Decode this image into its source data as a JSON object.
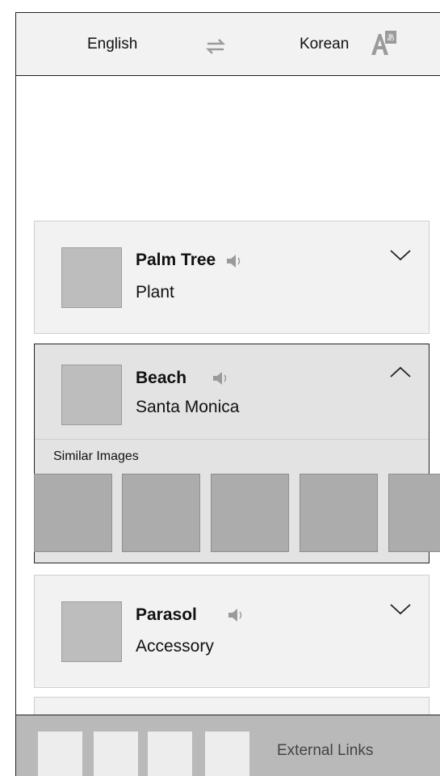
{
  "header": {
    "source_language": "English",
    "target_language": "Korean",
    "swap_icon": "swap-arrows-icon",
    "translate_icon": "translate-icon"
  },
  "results": [
    {
      "word": "Palm Tree",
      "category": "Plant",
      "expanded": false
    },
    {
      "word": "Beach",
      "category": "Santa Monica",
      "expanded": true,
      "similar_images_label": "Similar Images"
    },
    {
      "word": "Parasol",
      "category": "Accessory",
      "expanded": false
    }
  ],
  "footer": {
    "external_links_label": "External Links"
  },
  "colors": {
    "header_bg": "#f2f2f2",
    "card_bg": "#f2f2f2",
    "expanded_bg": "#e3e3e3",
    "footer_bg": "#b9b9b9"
  }
}
